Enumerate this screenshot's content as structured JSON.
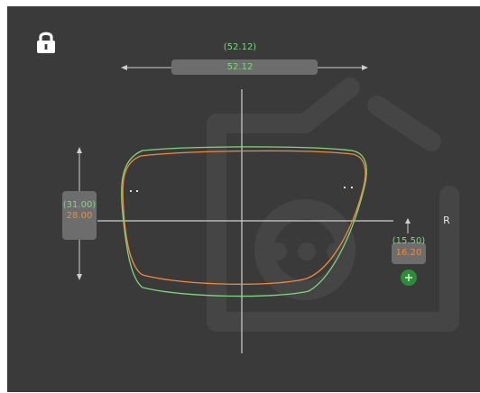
{
  "width_readout": {
    "measured": "(52.12)",
    "value": "52.12"
  },
  "height_readout": {
    "measured": "(31.00)",
    "value": "28.00"
  },
  "offset_readout": {
    "measured": "(15.50)",
    "value": "16.20"
  },
  "side_label": "R",
  "lock_state": "locked",
  "icons": [
    "lock-icon",
    "add-icon",
    "watermark-logo"
  ],
  "colors": {
    "background": "#3a3a3a",
    "measured": "#7fd67f",
    "adjusted": "#f08a3c",
    "guide": "#cfcfcf",
    "control": "#6d6d6d",
    "add_button": "#2e8b3a"
  }
}
